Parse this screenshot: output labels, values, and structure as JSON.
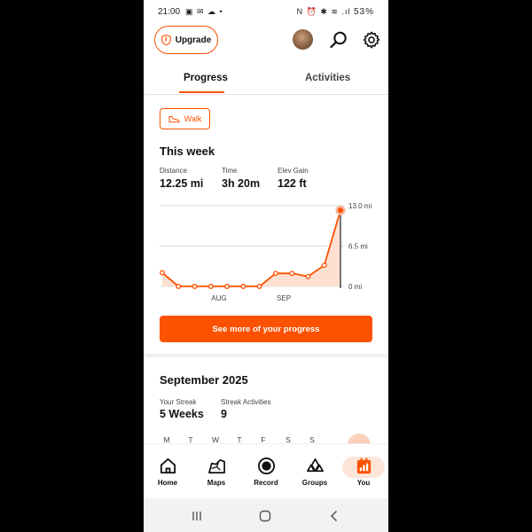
{
  "status_bar": {
    "time": "21:00",
    "left_icons": "▣ ✉ ☁ •",
    "right_icons": "N ⏰ ✱ ≋ .ıl",
    "battery": "53%"
  },
  "header": {
    "upgrade_label": "Upgrade"
  },
  "tabs": [
    {
      "label": "Progress",
      "active": true
    },
    {
      "label": "Activities",
      "active": false
    }
  ],
  "filter": {
    "sport": "Walk"
  },
  "week": {
    "title": "This week",
    "stats": [
      {
        "label": "Distance",
        "value": "12.25 mi"
      },
      {
        "label": "Time",
        "value": "3h 20m"
      },
      {
        "label": "Elev Gain",
        "value": "122 ft"
      }
    ]
  },
  "chart_data": {
    "type": "area",
    "x_tick_labels": [
      "AUG",
      "SEP"
    ],
    "y_tick_labels": [
      "13.0 mi",
      "6.5 mi",
      "0 mi"
    ],
    "ylim": [
      0,
      13.0
    ],
    "values": [
      2.2,
      0,
      0,
      0,
      0,
      0,
      0,
      2.1,
      2.1,
      1.6,
      3.4,
      12.25
    ],
    "highlight_index": 11,
    "grid": true,
    "color": "#fc5200"
  },
  "cta_label": "See more of your progress",
  "month": {
    "title": "September 2025",
    "streaks": [
      {
        "label": "Your Streak",
        "value": "5 Weeks"
      },
      {
        "label": "Streak Activities",
        "value": "9"
      }
    ],
    "weekdays": [
      "M",
      "T",
      "W",
      "T",
      "F",
      "S",
      "S"
    ]
  },
  "bottom_nav": [
    {
      "label": "Home",
      "icon": "home-icon"
    },
    {
      "label": "Maps",
      "icon": "maps-icon"
    },
    {
      "label": "Record",
      "icon": "record-icon"
    },
    {
      "label": "Groups",
      "icon": "groups-icon"
    },
    {
      "label": "You",
      "icon": "you-icon",
      "active": true
    }
  ],
  "colors": {
    "accent": "#fc5200",
    "accent_light": "#fde5d9"
  }
}
